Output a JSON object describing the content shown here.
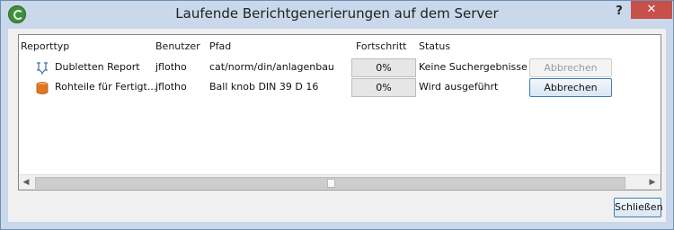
{
  "window": {
    "title": "Laufende Berichtgenerierungen auf dem Server",
    "help_label": "?",
    "close_label": "✕"
  },
  "table": {
    "columns": [
      "Reporttyp",
      "Benutzer",
      "Pfad",
      "Fortschritt",
      "Status"
    ],
    "rows": [
      {
        "icon": "duplicate-report-icon",
        "reporttyp": "Dubletten Report",
        "benutzer": "jflotho",
        "pfad": "cat/norm/din/anlagenbau",
        "fortschritt": "0%",
        "status": "Keine Suchergebnisse",
        "action_label": "Abbrechen",
        "action_enabled": false
      },
      {
        "icon": "raw-part-icon",
        "reporttyp": "Rohteile für Fertigt...",
        "benutzer": "jflotho",
        "pfad": "Ball knob DIN 39 D 16",
        "fortschritt": "0%",
        "status": "Wird ausgeführt",
        "action_label": "Abbrechen",
        "action_enabled": true
      }
    ]
  },
  "scrollbar": {
    "left_arrow": "◀",
    "right_arrow": "▶"
  },
  "footer": {
    "close_button_label": "Schließen"
  },
  "colors": {
    "title_bar": "#c9d8ea",
    "close_button": "#c7504a",
    "accent_border": "#3c7fb1"
  }
}
